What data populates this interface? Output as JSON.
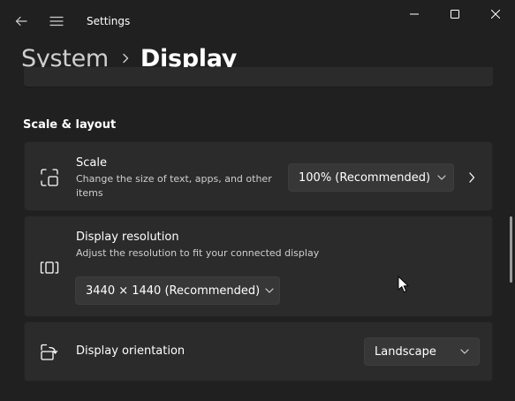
{
  "window": {
    "title": "Settings",
    "controls": [
      "minimize-icon",
      "maximize-icon",
      "close-icon"
    ]
  },
  "breadcrumb": {
    "parent": "System",
    "current": "Display"
  },
  "section": {
    "title": "Scale & layout"
  },
  "cards": {
    "scale": {
      "icon": "scale-icon",
      "title": "Scale",
      "description_line1": "Change the size of text, apps, and other",
      "description_line2": "items",
      "dropdown_value": "100% (Recommended)"
    },
    "resolution": {
      "icon": "resolution-icon",
      "title": "Display resolution",
      "description": "Adjust the resolution to fit your connected display",
      "dropdown_value": "3440 × 1440 (Recommended)"
    },
    "orientation": {
      "icon": "orientation-icon",
      "title": "Display orientation",
      "dropdown_value": "Landscape"
    }
  },
  "colors": {
    "background": "#202020",
    "card": "#2b2b2b",
    "dropdown": "#373737",
    "text": "#ffffff",
    "secondary_text": "#cfcfcf"
  }
}
